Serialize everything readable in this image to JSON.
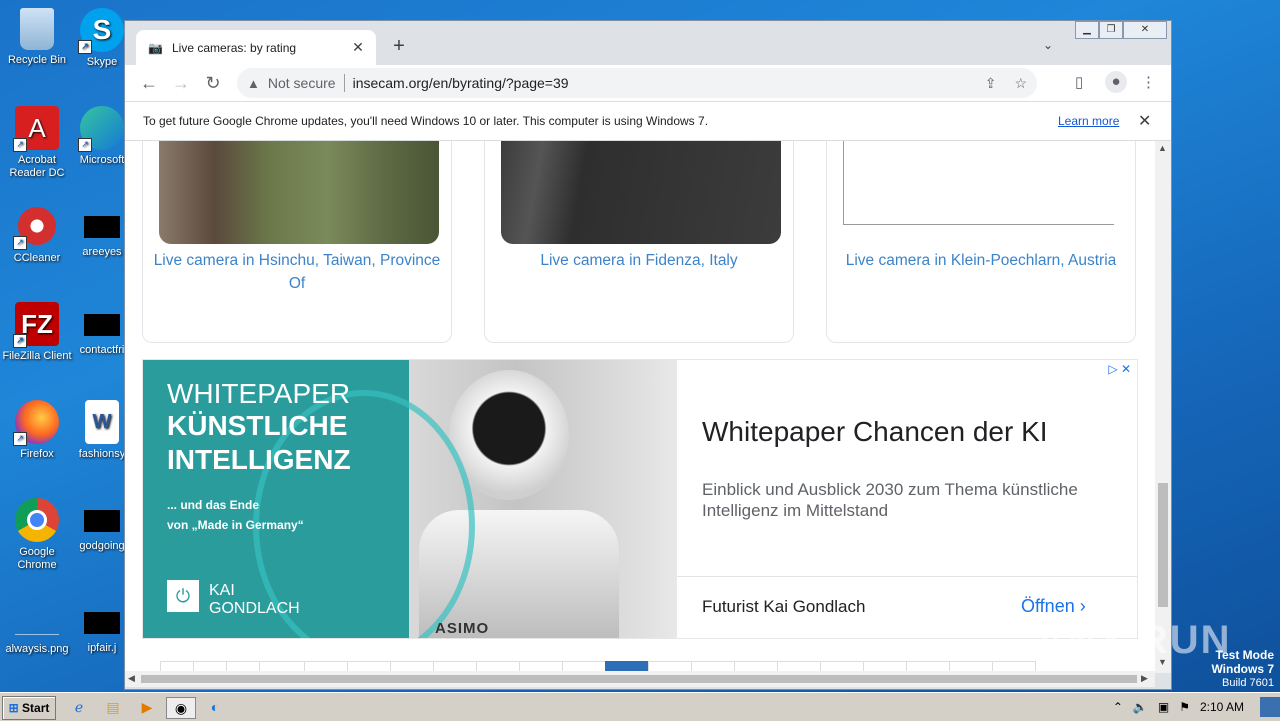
{
  "desktop": {
    "icons": [
      {
        "label": "Recycle Bin"
      },
      {
        "label": "Skype"
      },
      {
        "label": "Acrobat Reader DC"
      },
      {
        "label": "Microsoft"
      },
      {
        "label": "CCleaner"
      },
      {
        "label": "areeyes"
      },
      {
        "label": "FileZilla Client"
      },
      {
        "label": "contactfri"
      },
      {
        "label": "Firefox"
      },
      {
        "label": "fashionsy"
      },
      {
        "label": "Google Chrome"
      },
      {
        "label": "godgoing"
      },
      {
        "label": "alwaysis.png"
      },
      {
        "label": "ipfair.j"
      }
    ]
  },
  "browser": {
    "tab_title": "Live cameras: by rating",
    "not_secure": "Not secure",
    "url": "insecam.org/en/byrating/?page=39",
    "infobar_message": "To get future Google Chrome updates, you'll need Windows 10 or later. This computer is using Windows 7.",
    "infobar_link": "Learn more"
  },
  "page": {
    "cards": [
      {
        "caption": "Live camera in Hsinchu, Taiwan, Province Of"
      },
      {
        "caption": "Live camera in Fidenza, Italy"
      },
      {
        "caption": "Live camera in Klein-Poechlarn, Austria"
      }
    ],
    "ad": {
      "img_line1": "WHITEPAPER",
      "img_line2": "KÜNSTLICHE",
      "img_line3": "INTELLIGENZ",
      "img_sub1": "... und das Ende",
      "img_sub2": "von „Made in Germany“",
      "img_brand1": "KAI",
      "img_brand2": "GONDLACH",
      "img_robot_text": "ASIMO",
      "heading": "Whitepaper Chancen der KI",
      "description": "Einblick und Ausblick 2030 zum Thema künstliche Intelligenz im Mittelstand",
      "advertiser": "Futurist Kai Gondlach",
      "cta": "Öffnen"
    }
  },
  "taskbar": {
    "start": "Start",
    "clock": "2:10 AM"
  },
  "overlay": {
    "watermark": "ANY RUN",
    "testmode_line1": "Test Mode",
    "testmode_line2": "Windows 7",
    "testmode_line3": "Build 7601"
  },
  "colors": {
    "link": "#3d83c9",
    "ad_teal": "#2a9c9c",
    "cta": "#1a73e8",
    "pagination_active": "#2c6fb6"
  }
}
